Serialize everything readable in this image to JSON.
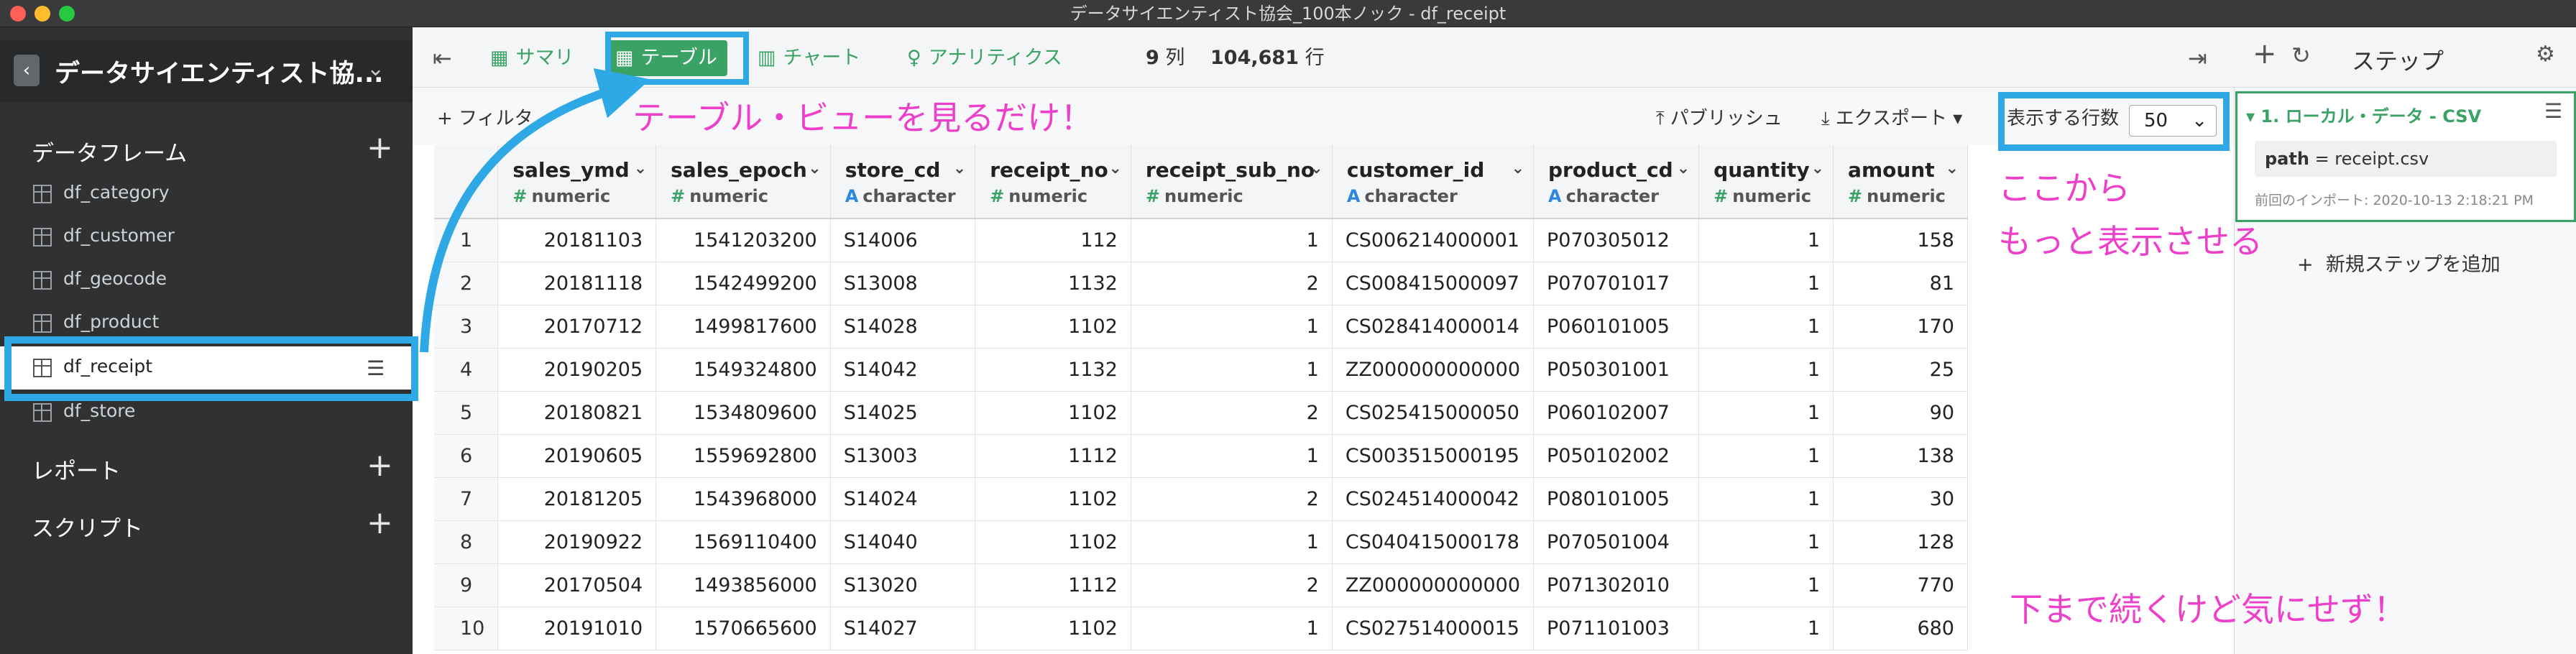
{
  "window": {
    "title": "データサイエンティスト協会_100本ノック - df_receipt"
  },
  "sidebar": {
    "back_icon": "chevron-left-icon",
    "project_name": "データサイエンティスト協...",
    "dataframes_label": "データフレーム",
    "dataframes": [
      {
        "label": "df_category"
      },
      {
        "label": "df_customer"
      },
      {
        "label": "df_geocode"
      },
      {
        "label": "df_product"
      },
      {
        "label": "df_receipt",
        "selected": true
      },
      {
        "label": "df_store"
      }
    ],
    "reports_label": "レポート",
    "scripts_label": "スクリプト"
  },
  "toolbar": {
    "summary": "サマリ",
    "table": "テーブル",
    "chart": "チャート",
    "analytics": "アナリティクス",
    "col_count": "9",
    "col_unit": "列",
    "row_count": "104,681",
    "row_unit": "行"
  },
  "filterbar": {
    "filter": "+ フィルタ",
    "publish": "パブリッシュ",
    "export": "エクスポート",
    "rows_label": "表示する行数",
    "rows_value": "50"
  },
  "table": {
    "columns": [
      {
        "name": "sales_ymd",
        "type": "numeric"
      },
      {
        "name": "sales_epoch",
        "type": "numeric"
      },
      {
        "name": "store_cd",
        "type": "character"
      },
      {
        "name": "receipt_no",
        "type": "numeric"
      },
      {
        "name": "receipt_sub_no",
        "type": "numeric"
      },
      {
        "name": "customer_id",
        "type": "character"
      },
      {
        "name": "product_cd",
        "type": "character"
      },
      {
        "name": "quantity",
        "type": "numeric"
      },
      {
        "name": "amount",
        "type": "numeric"
      }
    ],
    "rows": [
      [
        "1",
        "20181103",
        "1541203200",
        "S14006",
        "112",
        "1",
        "CS006214000001",
        "P070305012",
        "1",
        "158"
      ],
      [
        "2",
        "20181118",
        "1542499200",
        "S13008",
        "1132",
        "2",
        "CS008415000097",
        "P070701017",
        "1",
        "81"
      ],
      [
        "3",
        "20170712",
        "1499817600",
        "S14028",
        "1102",
        "1",
        "CS028414000014",
        "P060101005",
        "1",
        "170"
      ],
      [
        "4",
        "20190205",
        "1549324800",
        "S14042",
        "1132",
        "1",
        "ZZ000000000000",
        "P050301001",
        "1",
        "25"
      ],
      [
        "5",
        "20180821",
        "1534809600",
        "S14025",
        "1102",
        "2",
        "CS025415000050",
        "P060102007",
        "1",
        "90"
      ],
      [
        "6",
        "20190605",
        "1559692800",
        "S13003",
        "1112",
        "1",
        "CS003515000195",
        "P050102002",
        "1",
        "138"
      ],
      [
        "7",
        "20181205",
        "1543968000",
        "S14024",
        "1102",
        "2",
        "CS024514000042",
        "P080101005",
        "1",
        "30"
      ],
      [
        "8",
        "20190922",
        "1569110400",
        "S14040",
        "1102",
        "1",
        "CS040415000178",
        "P070501004",
        "1",
        "128"
      ],
      [
        "9",
        "20170504",
        "1493856000",
        "S13020",
        "1112",
        "2",
        "ZZ000000000000",
        "P071302010",
        "1",
        "770"
      ],
      [
        "10",
        "20191010",
        "1570665600",
        "S14027",
        "1102",
        "1",
        "CS027514000015",
        "P071101003",
        "1",
        "680"
      ]
    ]
  },
  "steps": {
    "title": "ステップ",
    "step1_title": "1. ローカル・データ - CSV",
    "step1_key": "path",
    "step1_value": " = receipt.csv",
    "step1_import": "前回のインポート: 2020-10-13 2:18:21 PM",
    "add_step": "新規ステップを追加"
  },
  "annotations": {
    "a1": "テーブル・ビューを見るだけ！",
    "a2": "ここから",
    "a3": "もっと表示させる",
    "a4": "下まで続くけど気にせず！",
    "color": "#ee3fcb",
    "highlight_color": "#2fa9e6"
  },
  "colors": {
    "accent": "#3aa264",
    "sidebar_bg": "#2f3133",
    "character_type": "#2e86de"
  }
}
